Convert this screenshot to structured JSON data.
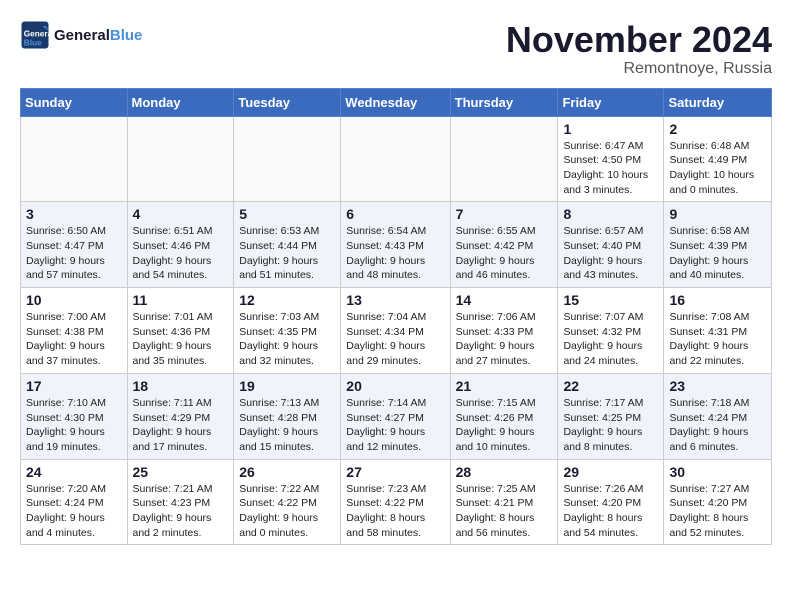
{
  "logo": {
    "line1": "General",
    "line2": "Blue"
  },
  "title": "November 2024",
  "location": "Remontnoye, Russia",
  "days_of_week": [
    "Sunday",
    "Monday",
    "Tuesday",
    "Wednesday",
    "Thursday",
    "Friday",
    "Saturday"
  ],
  "weeks": [
    [
      {
        "day": "",
        "info": ""
      },
      {
        "day": "",
        "info": ""
      },
      {
        "day": "",
        "info": ""
      },
      {
        "day": "",
        "info": ""
      },
      {
        "day": "",
        "info": ""
      },
      {
        "day": "1",
        "info": "Sunrise: 6:47 AM\nSunset: 4:50 PM\nDaylight: 10 hours and 3 minutes."
      },
      {
        "day": "2",
        "info": "Sunrise: 6:48 AM\nSunset: 4:49 PM\nDaylight: 10 hours and 0 minutes."
      }
    ],
    [
      {
        "day": "3",
        "info": "Sunrise: 6:50 AM\nSunset: 4:47 PM\nDaylight: 9 hours and 57 minutes."
      },
      {
        "day": "4",
        "info": "Sunrise: 6:51 AM\nSunset: 4:46 PM\nDaylight: 9 hours and 54 minutes."
      },
      {
        "day": "5",
        "info": "Sunrise: 6:53 AM\nSunset: 4:44 PM\nDaylight: 9 hours and 51 minutes."
      },
      {
        "day": "6",
        "info": "Sunrise: 6:54 AM\nSunset: 4:43 PM\nDaylight: 9 hours and 48 minutes."
      },
      {
        "day": "7",
        "info": "Sunrise: 6:55 AM\nSunset: 4:42 PM\nDaylight: 9 hours and 46 minutes."
      },
      {
        "day": "8",
        "info": "Sunrise: 6:57 AM\nSunset: 4:40 PM\nDaylight: 9 hours and 43 minutes."
      },
      {
        "day": "9",
        "info": "Sunrise: 6:58 AM\nSunset: 4:39 PM\nDaylight: 9 hours and 40 minutes."
      }
    ],
    [
      {
        "day": "10",
        "info": "Sunrise: 7:00 AM\nSunset: 4:38 PM\nDaylight: 9 hours and 37 minutes."
      },
      {
        "day": "11",
        "info": "Sunrise: 7:01 AM\nSunset: 4:36 PM\nDaylight: 9 hours and 35 minutes."
      },
      {
        "day": "12",
        "info": "Sunrise: 7:03 AM\nSunset: 4:35 PM\nDaylight: 9 hours and 32 minutes."
      },
      {
        "day": "13",
        "info": "Sunrise: 7:04 AM\nSunset: 4:34 PM\nDaylight: 9 hours and 29 minutes."
      },
      {
        "day": "14",
        "info": "Sunrise: 7:06 AM\nSunset: 4:33 PM\nDaylight: 9 hours and 27 minutes."
      },
      {
        "day": "15",
        "info": "Sunrise: 7:07 AM\nSunset: 4:32 PM\nDaylight: 9 hours and 24 minutes."
      },
      {
        "day": "16",
        "info": "Sunrise: 7:08 AM\nSunset: 4:31 PM\nDaylight: 9 hours and 22 minutes."
      }
    ],
    [
      {
        "day": "17",
        "info": "Sunrise: 7:10 AM\nSunset: 4:30 PM\nDaylight: 9 hours and 19 minutes."
      },
      {
        "day": "18",
        "info": "Sunrise: 7:11 AM\nSunset: 4:29 PM\nDaylight: 9 hours and 17 minutes."
      },
      {
        "day": "19",
        "info": "Sunrise: 7:13 AM\nSunset: 4:28 PM\nDaylight: 9 hours and 15 minutes."
      },
      {
        "day": "20",
        "info": "Sunrise: 7:14 AM\nSunset: 4:27 PM\nDaylight: 9 hours and 12 minutes."
      },
      {
        "day": "21",
        "info": "Sunrise: 7:15 AM\nSunset: 4:26 PM\nDaylight: 9 hours and 10 minutes."
      },
      {
        "day": "22",
        "info": "Sunrise: 7:17 AM\nSunset: 4:25 PM\nDaylight: 9 hours and 8 minutes."
      },
      {
        "day": "23",
        "info": "Sunrise: 7:18 AM\nSunset: 4:24 PM\nDaylight: 9 hours and 6 minutes."
      }
    ],
    [
      {
        "day": "24",
        "info": "Sunrise: 7:20 AM\nSunset: 4:24 PM\nDaylight: 9 hours and 4 minutes."
      },
      {
        "day": "25",
        "info": "Sunrise: 7:21 AM\nSunset: 4:23 PM\nDaylight: 9 hours and 2 minutes."
      },
      {
        "day": "26",
        "info": "Sunrise: 7:22 AM\nSunset: 4:22 PM\nDaylight: 9 hours and 0 minutes."
      },
      {
        "day": "27",
        "info": "Sunrise: 7:23 AM\nSunset: 4:22 PM\nDaylight: 8 hours and 58 minutes."
      },
      {
        "day": "28",
        "info": "Sunrise: 7:25 AM\nSunset: 4:21 PM\nDaylight: 8 hours and 56 minutes."
      },
      {
        "day": "29",
        "info": "Sunrise: 7:26 AM\nSunset: 4:20 PM\nDaylight: 8 hours and 54 minutes."
      },
      {
        "day": "30",
        "info": "Sunrise: 7:27 AM\nSunset: 4:20 PM\nDaylight: 8 hours and 52 minutes."
      }
    ]
  ]
}
